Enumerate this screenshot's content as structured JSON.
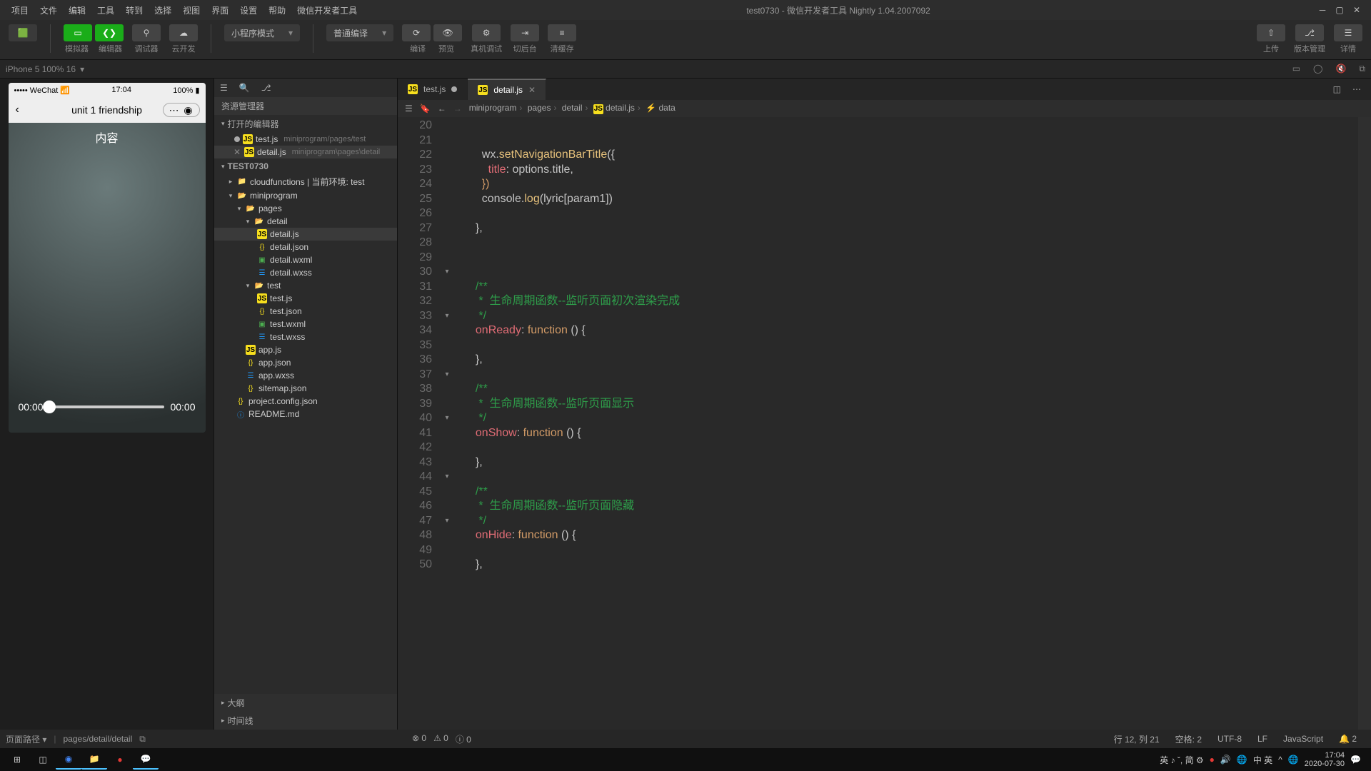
{
  "app_icon": "🟩",
  "menu": [
    "项目",
    "文件",
    "编辑",
    "工具",
    "转到",
    "选择",
    "视图",
    "界面",
    "设置",
    "帮助",
    "微信开发者工具"
  ],
  "title_center": "test0730 - 微信开发者工具 Nightly 1.04.2007092",
  "toolbar": {
    "sim": "模拟器",
    "editor": "编辑器",
    "debugger": "调试器",
    "cloud": "云开发",
    "mode": "小程序模式",
    "compileMode": "普通编译",
    "compile": "编译",
    "preview": "预览",
    "realdevice": "真机调试",
    "background": "切后台",
    "clearCache": "清缓存",
    "upload": "上传",
    "version": "版本管理",
    "detail": "详情"
  },
  "devbar": {
    "device": "iPhone 5 100% 16",
    "arrow": "▾"
  },
  "phone": {
    "carrier": "••••• WeChat",
    "time": "17:04",
    "battery": "100%",
    "navTitle": "unit 1 friendship",
    "heading": "内容",
    "timeStart": "00:00",
    "timeEnd": "00:00"
  },
  "explorer": {
    "title": "资源管理器",
    "openEditors": "打开的编辑器",
    "open": [
      {
        "name": "test.js",
        "path": "miniprogram/pages/test",
        "dirty": true
      },
      {
        "name": "detail.js",
        "path": "miniprogram\\pages\\detail",
        "close": true
      }
    ],
    "projectSection": "TEST0730",
    "tree": {
      "cloud": "cloudfunctions | 当前环境: test",
      "miniprogram": "miniprogram",
      "pages": "pages",
      "detail": "detail",
      "detail_files": [
        "detail.js",
        "detail.json",
        "detail.wxml",
        "detail.wxss"
      ],
      "test": "test",
      "test_files": [
        "test.js",
        "test.json",
        "test.wxml",
        "test.wxss"
      ],
      "root_files": [
        "app.js",
        "app.json",
        "app.wxss",
        "sitemap.json"
      ],
      "project_config": "project.config.json",
      "readme": "README.md"
    },
    "outline": "大纲",
    "timeline": "时间线"
  },
  "tabs": {
    "t1": "test.js",
    "t2": "detail.js"
  },
  "breadcrumb": [
    "miniprogram",
    "pages",
    "detail",
    "detail.js",
    "data"
  ],
  "code": {
    "l20": "",
    "l21a": "    wx.",
    "l21b": "setNavigationBarTitle",
    "l21c": "({",
    "l22a": "      title",
    "l22b": ": options.title,",
    "l23": "    })",
    "l24a": "    console.",
    "l24b": "log",
    "l24c": "(lyric[param1])",
    "l25": "",
    "l26": "  },",
    "l27": "",
    "l28": "",
    "l29": "",
    "l30": "  /**",
    "l31": "   *  生命周期函数--监听页面初次渲染完成",
    "l32": "   */",
    "l33a": "  ",
    "l33b": "onReady",
    "l33c": ": ",
    "l33d": "function",
    "l33e": " () {",
    "l34": "",
    "l35": "  },",
    "l36": "",
    "l37": "  /**",
    "l38": "   *  生命周期函数--监听页面显示",
    "l39": "   */",
    "l40a": "  ",
    "l40b": "onShow",
    "l40c": ": ",
    "l40d": "function",
    "l40e": " () {",
    "l41": "",
    "l42": "  },",
    "l43": "",
    "l44": "  /**",
    "l45": "   *  生命周期函数--监听页面隐藏",
    "l46": "   */",
    "l47a": "  ",
    "l47b": "onHide",
    "l47c": ": ",
    "l47d": "function",
    "l47e": " () {",
    "l48": "",
    "l49": "  },",
    "l50": ""
  },
  "lines": [
    20,
    21,
    22,
    23,
    24,
    25,
    26,
    27,
    28,
    29,
    30,
    31,
    32,
    33,
    34,
    35,
    36,
    37,
    38,
    39,
    40,
    41,
    42,
    43,
    44,
    45,
    46,
    47,
    48,
    49,
    50
  ],
  "simstatus": {
    "left": "页面路径",
    "path": "pages/detail/detail"
  },
  "edstatus": {
    "pos": "行 12, 列 21",
    "spaces": "空格: 2",
    "enc": "UTF-8",
    "eol": "LF",
    "lang": "JavaScript"
  },
  "taskbar": {
    "ime": "英 ♪ ˇ, 简 ⚙",
    "time": "17:04",
    "date": "2020-07-30"
  }
}
